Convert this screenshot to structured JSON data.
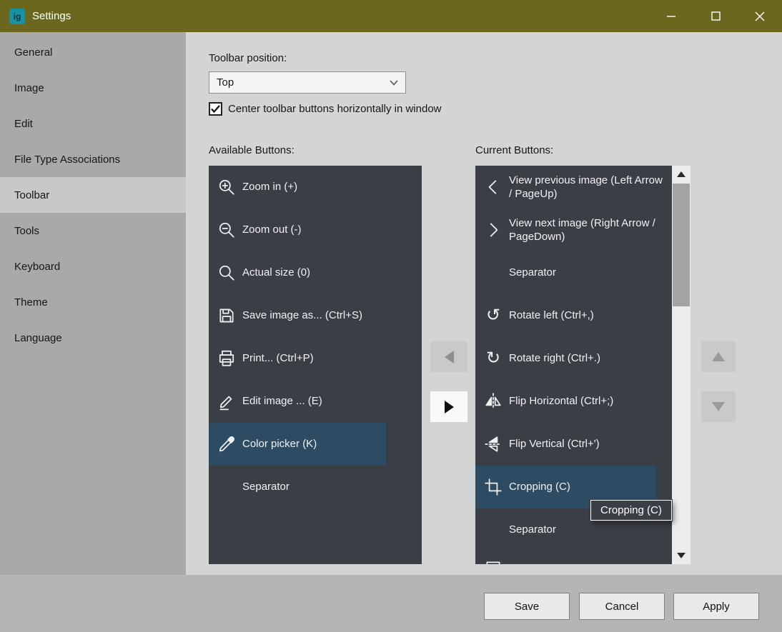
{
  "window": {
    "title": "Settings",
    "app_icon_text": "ig",
    "controls": {
      "minimize": "minimize",
      "maximize": "maximize",
      "close": "close"
    }
  },
  "sidebar": {
    "items": [
      {
        "label": "General",
        "selected": false
      },
      {
        "label": "Image",
        "selected": false
      },
      {
        "label": "Edit",
        "selected": false
      },
      {
        "label": "File Type Associations",
        "selected": false
      },
      {
        "label": "Toolbar",
        "selected": true
      },
      {
        "label": "Tools",
        "selected": false
      },
      {
        "label": "Keyboard",
        "selected": false
      },
      {
        "label": "Theme",
        "selected": false
      },
      {
        "label": "Language",
        "selected": false
      }
    ]
  },
  "content": {
    "toolbar_position_label": "Toolbar position:",
    "toolbar_position_value": "Top",
    "center_checkbox": {
      "checked": true,
      "label": "Center toolbar buttons horizontally in window"
    },
    "available_label": "Available Buttons:",
    "current_label": "Current Buttons:",
    "available_buttons": [
      {
        "label": "Zoom in (+)",
        "icon": "zoom-in-icon",
        "selected": false
      },
      {
        "label": "Zoom out (-)",
        "icon": "zoom-out-icon",
        "selected": false
      },
      {
        "label": "Actual size (0)",
        "icon": "actual-size-icon",
        "selected": false
      },
      {
        "label": "Save image as... (Ctrl+S)",
        "icon": "save-icon",
        "selected": false
      },
      {
        "label": "Print... (Ctrl+P)",
        "icon": "print-icon",
        "selected": false
      },
      {
        "label": "Edit image ... (E)",
        "icon": "edit-image-icon",
        "selected": false
      },
      {
        "label": "Color picker (K)",
        "icon": "color-picker-icon",
        "selected": true
      },
      {
        "label": "Separator",
        "icon": null,
        "selected": false
      }
    ],
    "current_buttons": [
      {
        "label": "View previous image (Left Arrow / PageUp)",
        "icon": "previous-image-icon",
        "selected": false
      },
      {
        "label": "View next image (Right Arrow / PageDown)",
        "icon": "next-image-icon",
        "selected": false
      },
      {
        "label": "Separator",
        "icon": null,
        "selected": false
      },
      {
        "label": "Rotate left (Ctrl+,)",
        "icon": "rotate-left-icon",
        "selected": false
      },
      {
        "label": "Rotate right (Ctrl+.)",
        "icon": "rotate-right-icon",
        "selected": false
      },
      {
        "label": "Flip Horizontal (Ctrl+;)",
        "icon": "flip-horizontal-icon",
        "selected": false
      },
      {
        "label": "Flip Vertical (Ctrl+')",
        "icon": "flip-vertical-icon",
        "selected": false
      },
      {
        "label": "Cropping (C)",
        "icon": "crop-icon",
        "selected": true
      },
      {
        "label": "Separator",
        "icon": null,
        "selected": false
      },
      {
        "label": "",
        "icon": "clipped-button-icon",
        "selected": false,
        "partial": true
      }
    ],
    "tooltip": "Cropping (C)"
  },
  "footer": {
    "save": "Save",
    "cancel": "Cancel",
    "apply": "Apply"
  },
  "colors": {
    "titlebar": "#6c671f",
    "sidebar": "#a9a9a9",
    "sidebar_selected": "#c8c8c8",
    "content_bg": "#d4d4d4",
    "list_bg": "#3a3f46",
    "selection": "#2d4b63",
    "footer_bg": "#b5b5b5"
  }
}
